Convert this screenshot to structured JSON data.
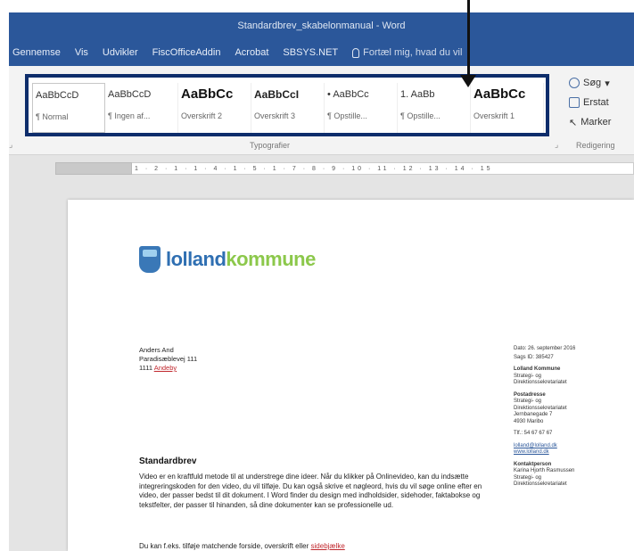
{
  "window": {
    "title": "Standardbrev_skabelonmanual - Word"
  },
  "tabs": [
    "Gennemse",
    "Vis",
    "Udvikler",
    "FiscOfficeAddin",
    "Acrobat",
    "SBSYS.NET"
  ],
  "tell_me": "Fortæl mig, hvad du vil",
  "styles": [
    {
      "sample": "AaBbCcD",
      "name": "¶ Normal",
      "kind": "normal"
    },
    {
      "sample": "AaBbCcD",
      "name": "¶ Ingen af...",
      "kind": "normal"
    },
    {
      "sample": "AaBbCc",
      "name": "Overskrift 2",
      "kind": "big"
    },
    {
      "sample": "AaBbCcI",
      "name": "Overskrift 3",
      "kind": "mid"
    },
    {
      "sample": "• AaBbCc",
      "name": "¶ Opstille...",
      "kind": "normal"
    },
    {
      "sample": "1.  AaBb",
      "name": "¶ Opstille...",
      "kind": "normal"
    },
    {
      "sample": "AaBbCc",
      "name": "Overskrift 1",
      "kind": "big"
    }
  ],
  "styles_group_label": "Typografier",
  "editing": {
    "find": "Søg",
    "replace": "Erstat",
    "select": "Marker",
    "group_label": "Redigering"
  },
  "ruler_text": "1 · 2 · 1 · 1 · 4 · 1 · 5 · 1 · 7 · 8 · 9 · 10 · 11 · 12 · 13 · 14 · 15",
  "logo": {
    "part1": "lolland",
    "part2": "kommune"
  },
  "recipient": {
    "name": "Anders And",
    "street": "Paradisæblevej 111",
    "zip": "1111",
    "city": "Andeby"
  },
  "sidebar": {
    "date": "Dato: 26. september 2016",
    "case_id": "Sags ID: 385427",
    "org_head": "Lolland Kommune",
    "org_l1": "Strategi- og",
    "org_l2": "Direktionssekretariatet",
    "post_head": "Postadresse",
    "post_l1": "Strategi- og",
    "post_l2": "Direktionssekretariatet",
    "post_l3": "Jernbanegade 7",
    "post_l4": "4930 Maribo",
    "phone": "Tlf.: 54 67 67 67",
    "email": "lolland@lolland.dk",
    "web": "www.lolland.dk",
    "contact_head": "Kontaktperson",
    "contact_l1": "Karina Hjorth Rasmussen",
    "contact_l2": "Strategi- og",
    "contact_l3": "Direktionssekretariatet"
  },
  "letter": {
    "title": "Standardbrev",
    "para1": "Video er en kraftfuld metode til at understrege dine ideer. Når du klikker på Onlinevideo, kan du indsætte integreringskoden for den video, du vil tilføje. Du kan også skrive et nøgleord, hvis du vil søge online efter en video, der passer bedst til dit dokument. I Word finder du design med indholdsider, sidehoder, faktabokse og tekstfelter, der passer til hinanden, så dine dokumenter kan se professionelle ud.",
    "para2_start": "Du kan f.eks. tilføje matchende forside, overskrift eller ",
    "para2_link": "sidebjælke"
  }
}
